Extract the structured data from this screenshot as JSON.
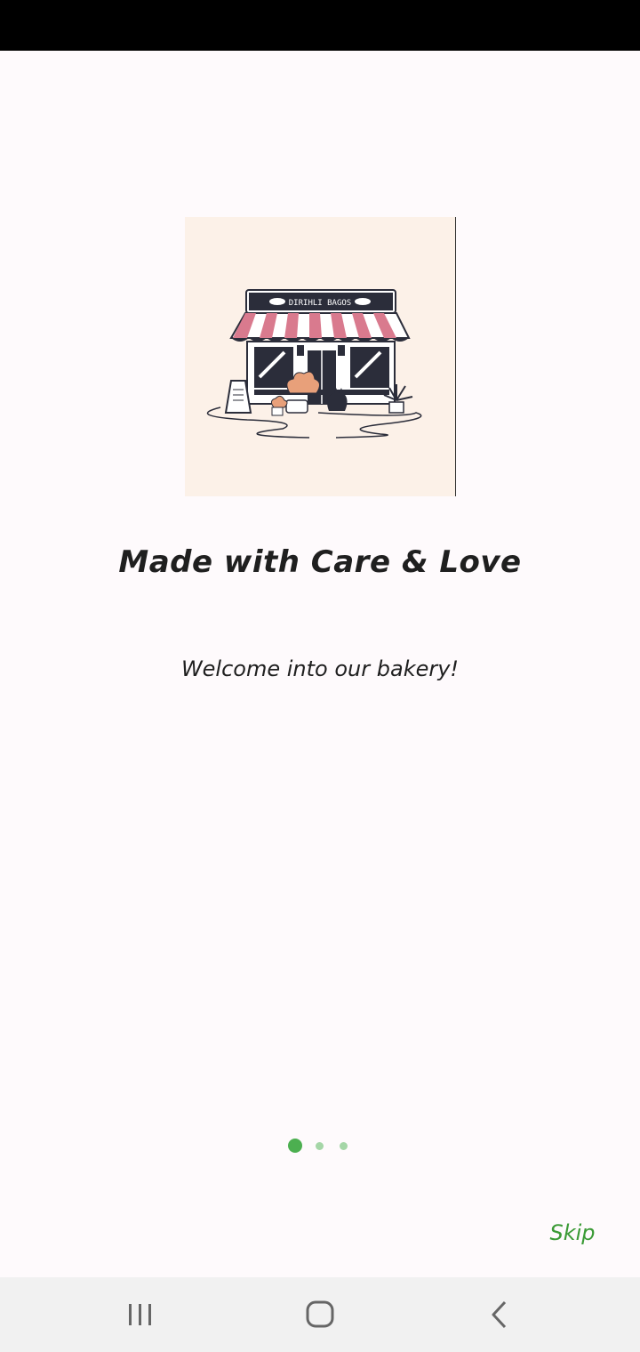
{
  "onboarding": {
    "title": "Made with Care & Love",
    "subtitle": "Welcome into our bakery!",
    "illustration": {
      "icon": "bakery-storefront-icon",
      "sign_text": "DIRIHLI BAGOS",
      "background_color": "#fcf1e8",
      "awning_color": "#d97a8e"
    },
    "pager": {
      "count": 3,
      "active": 1,
      "active_color": "#4caf50",
      "inactive_color": "#a5d6a7"
    },
    "skip_label": "Skip",
    "accent_color": "#3a9a35"
  },
  "nav_bar": {
    "recents_icon": "recents-icon",
    "home_icon": "home-icon",
    "back_icon": "back-icon"
  }
}
